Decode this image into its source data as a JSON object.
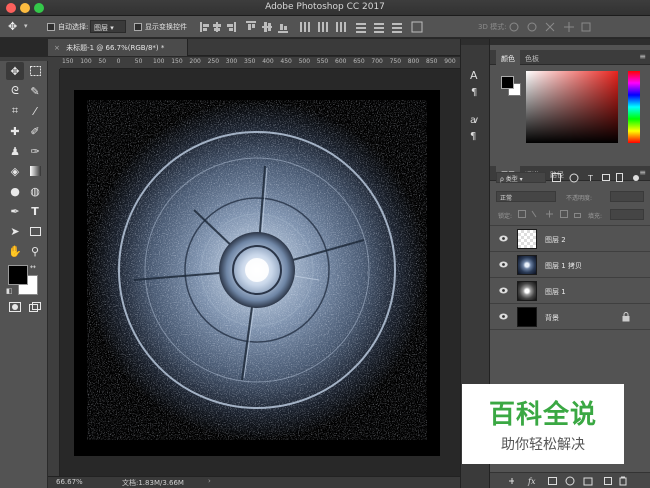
{
  "window": {
    "title": "Adobe Photoshop CC 2017"
  },
  "options": {
    "auto_select_label": "自动选择:",
    "auto_select_value": "图层",
    "show_transform_label": "显示变换控件",
    "mode_3d_label": "3D 模式:"
  },
  "document": {
    "tab_label": "未标题-1 @ 66.7%(RGB/8*)",
    "tab_modified": "*",
    "zoom": "66.67%",
    "doc_info": "文档:1.83M/3.66M"
  },
  "ruler": {
    "labels": [
      "150",
      "100",
      "50",
      "0",
      "50",
      "100",
      "150",
      "200",
      "250",
      "300",
      "350",
      "400",
      "450",
      "500",
      "550",
      "600",
      "650",
      "700",
      "750",
      "800",
      "850",
      "900"
    ]
  },
  "color_panel": {
    "tabs": [
      "颜色",
      "色板"
    ],
    "foreground": "#000000",
    "background": "#ffffff"
  },
  "layers_panel": {
    "tabs": [
      "图层",
      "通道",
      "路径"
    ],
    "filter_label": "ρ 类型",
    "blend_mode": "正常",
    "opacity_label": "不透明度:",
    "lock_label": "锁定:",
    "fill_label": "填充:",
    "layers": [
      {
        "name": "图层 2",
        "thumb": "transparent"
      },
      {
        "name": "图层 1 拷贝",
        "thumb": "blue-rings"
      },
      {
        "name": "图层 1",
        "thumb": "gray-rings"
      },
      {
        "name": "背景",
        "thumb": "black",
        "locked": true
      }
    ]
  },
  "watermark": {
    "line1": "百科全说",
    "line2": "助你轻松解决"
  },
  "colors": {
    "accent_green": "#3aa843",
    "panel": "#535353",
    "dark": "#282828"
  }
}
